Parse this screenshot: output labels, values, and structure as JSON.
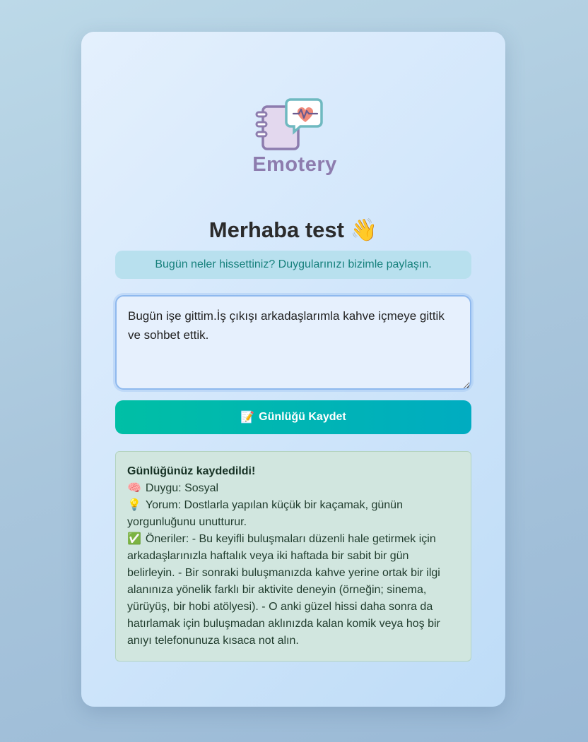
{
  "brand": {
    "name": "Emotery",
    "icon": "journal-heart-chat-icon",
    "color": "#8d7cae"
  },
  "greeting": {
    "text": "Merhaba test",
    "emoji": "👋"
  },
  "prompt": "Bugün neler hissettiniz? Duygularınızı bizimle paylaşın.",
  "entry": {
    "value": "Bugün işe gittim.İş çıkışı arkadaşlarımla kahve içmeye gittik ve sohbet ettik."
  },
  "save_button": {
    "emoji": "📝",
    "label": "Günlüğü Kaydet"
  },
  "result": {
    "heading": "Günlüğünüz kaydedildi!",
    "emotion_emoji": "🧠",
    "emotion": "Duygu: Sosyal",
    "comment_emoji": "💡",
    "comment": "Yorum: Dostlarla yapılan küçük bir kaçamak, günün yorgunluğunu unutturur.",
    "suggestions_emoji": "✅",
    "suggestions": "Öneriler: - Bu keyifli buluşmaları düzenli hale getirmek için arkadaşlarınızla haftalık veya iki haftada bir sabit bir gün belirleyin. - Bir sonraki buluşmanızda kahve yerine ortak bir ilgi alanınıza yönelik farklı bir aktivite deneyin (örneğin; sinema, yürüyüş, bir hobi atölyesi). - O anki güzel hissi daha sonra da hatırlamak için buluşmadan aklınızda kalan komik veya hoş bir anıyı telefonunuza kısaca not alın."
  },
  "colors": {
    "accent_start": "#00bfa5",
    "accent_end": "#00acc1",
    "prompt_bg": "#b8e0ee",
    "result_bg": "#d1e6df"
  }
}
